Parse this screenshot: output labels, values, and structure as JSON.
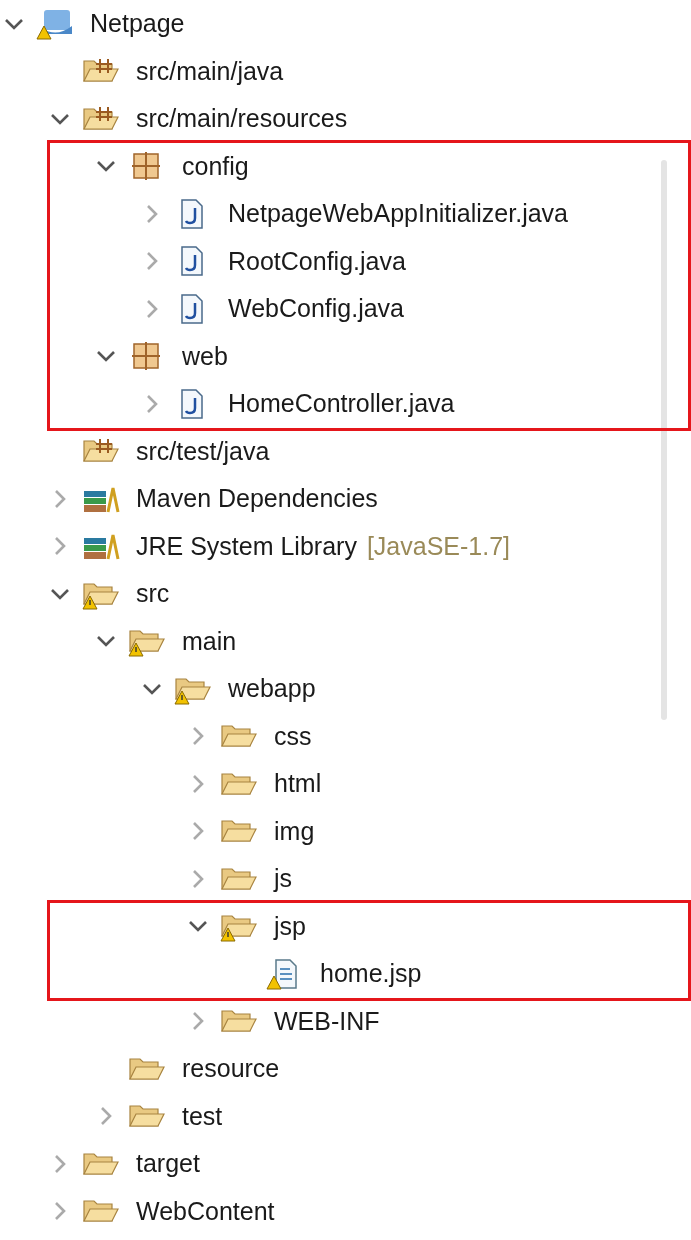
{
  "tree": [
    {
      "label": "Netpage",
      "kind": "project",
      "expanded": true,
      "children": [
        {
          "label": "src/main/java",
          "kind": "source-folder"
        },
        {
          "label": "src/main/resources",
          "kind": "source-folder",
          "expanded": true,
          "children": [
            {
              "label": "config",
              "kind": "package",
              "expanded": true,
              "highlighted": true,
              "children": [
                {
                  "label": "NetpageWebAppInitializer.java",
                  "kind": "java-file",
                  "expanded": false
                },
                {
                  "label": "RootConfig.java",
                  "kind": "java-file",
                  "expanded": false
                },
                {
                  "label": "WebConfig.java",
                  "kind": "java-file",
                  "expanded": false
                }
              ]
            },
            {
              "label": "web",
              "kind": "package",
              "expanded": true,
              "highlighted": true,
              "children": [
                {
                  "label": "HomeController.java",
                  "kind": "java-file",
                  "expanded": false
                }
              ]
            }
          ]
        },
        {
          "label": "src/test/java",
          "kind": "source-folder"
        },
        {
          "label": "Maven Dependencies",
          "kind": "library",
          "expanded": false
        },
        {
          "label": "JRE System Library",
          "decoration": "[JavaSE-1.7]",
          "kind": "library",
          "expanded": false
        },
        {
          "label": "src",
          "kind": "warning-folder",
          "expanded": true,
          "children": [
            {
              "label": "main",
              "kind": "warning-folder",
              "expanded": true,
              "children": [
                {
                  "label": "webapp",
                  "kind": "warning-folder",
                  "expanded": true,
                  "children": [
                    {
                      "label": "css",
                      "kind": "folder",
                      "expanded": false
                    },
                    {
                      "label": "html",
                      "kind": "folder",
                      "expanded": false
                    },
                    {
                      "label": "img",
                      "kind": "folder",
                      "expanded": false
                    },
                    {
                      "label": "js",
                      "kind": "folder",
                      "expanded": false
                    },
                    {
                      "label": "jsp",
                      "kind": "warning-folder",
                      "expanded": true,
                      "highlighted": true,
                      "children": [
                        {
                          "label": "home.jsp",
                          "kind": "jsp-file"
                        }
                      ]
                    },
                    {
                      "label": "WEB-INF",
                      "kind": "folder",
                      "expanded": false
                    }
                  ]
                }
              ]
            },
            {
              "label": "resource",
              "kind": "folder"
            },
            {
              "label": "test",
              "kind": "folder",
              "expanded": false
            }
          ]
        },
        {
          "label": "target",
          "kind": "folder",
          "expanded": false
        },
        {
          "label": "WebContent",
          "kind": "folder",
          "expanded": false
        }
      ]
    }
  ]
}
